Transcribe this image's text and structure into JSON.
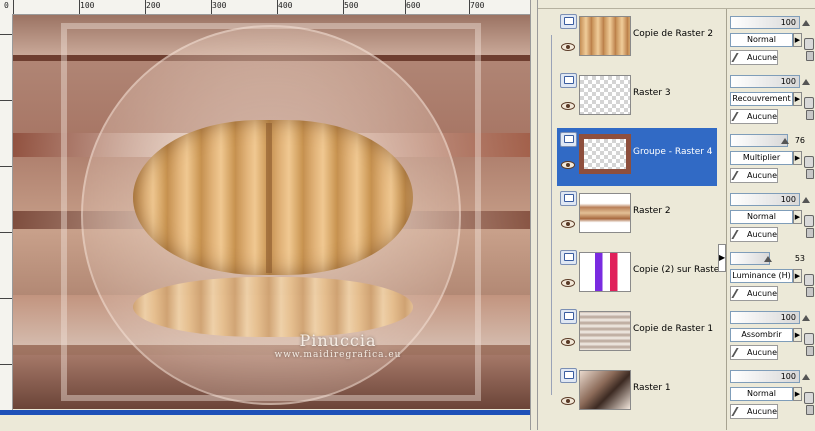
{
  "ruler": {
    "labels": [
      "0",
      "100",
      "200",
      "300",
      "400",
      "500",
      "600",
      "700"
    ]
  },
  "canvas": {
    "watermark_title": "Pinuccia",
    "watermark_url": "www.maidiregrafica.eu"
  },
  "layers": [
    {
      "name": "Copie de Raster 2",
      "opacity": "100",
      "blend": "Normal",
      "mask": "Aucune",
      "selected": false
    },
    {
      "name": "Raster 3",
      "opacity": "100",
      "blend": "Recouvrement",
      "mask": "Aucune",
      "selected": false
    },
    {
      "name": "Groupe - Raster 4",
      "opacity": "76",
      "blend": "Multiplier",
      "mask": "Aucune",
      "selected": true
    },
    {
      "name": "Raster 2",
      "opacity": "100",
      "blend": "Normal",
      "mask": "Aucune",
      "selected": false
    },
    {
      "name": "Copie (2) sur Raster",
      "opacity": "53",
      "blend": "Luminance (H)",
      "mask": "Aucune",
      "selected": false
    },
    {
      "name": "Copie de Raster 1",
      "opacity": "100",
      "blend": "Assombrir",
      "mask": "Aucune",
      "selected": false
    },
    {
      "name": "Raster 1",
      "opacity": "100",
      "blend": "Normal",
      "mask": "Aucune",
      "selected": false
    }
  ],
  "colors": {
    "selection": "#316ac5",
    "palette_bg": "#ece9d8"
  }
}
